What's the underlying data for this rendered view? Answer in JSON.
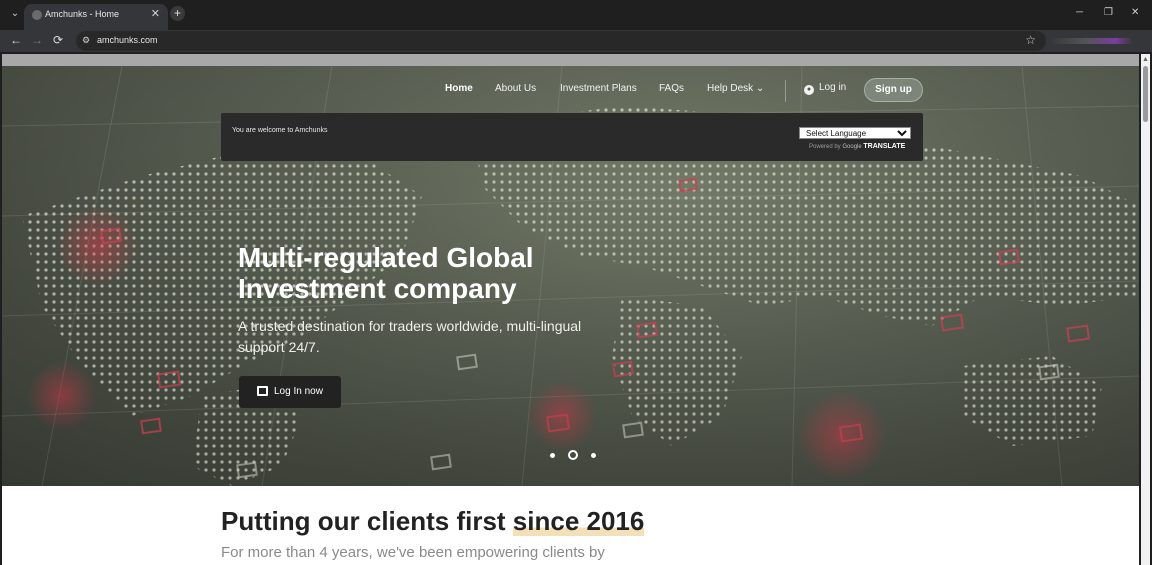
{
  "browser": {
    "tab_title": "Amchunks - Home",
    "url": "amchunks.com",
    "new_tab_label": "+",
    "close_tab_label": "✕",
    "minimize_label": "─",
    "restore_label": "❐",
    "close_window_label": "✕",
    "back_label": "←",
    "forward_label": "→",
    "reload_label": "⟳",
    "star_label": "☆",
    "tab_menu_label": "⌄"
  },
  "nav": {
    "items": [
      {
        "label": "Home",
        "active": true
      },
      {
        "label": "About Us"
      },
      {
        "label": "Investment Plans"
      },
      {
        "label": "FAQs"
      },
      {
        "label": "Help Desk ⌄"
      }
    ],
    "login_label": "Log in",
    "signup_label": "Sign up"
  },
  "welcome_bar": {
    "text": "You are welcome to Amchunks",
    "language_select": "Select Language",
    "powered_by": "Powered by",
    "google": "Google",
    "translate": "TRANSLATE"
  },
  "hero": {
    "title": "Multi-regulated Global Investment company",
    "subtitle": "A trusted destination for traders worldwide, multi-lingual support 24/7.",
    "cta_label": "Log In now",
    "slides": 3,
    "active_slide": 2
  },
  "section": {
    "title_plain": "Putting our clients first ",
    "title_highlight": "since 2016",
    "subtitle": "For more than 4 years, we've been empowering clients by"
  },
  "colors": {
    "hero_base": "#5f6658",
    "welcome_bar": "#2a2a2a",
    "cta_button": "#222222",
    "highlight": "#f3dfb8"
  }
}
